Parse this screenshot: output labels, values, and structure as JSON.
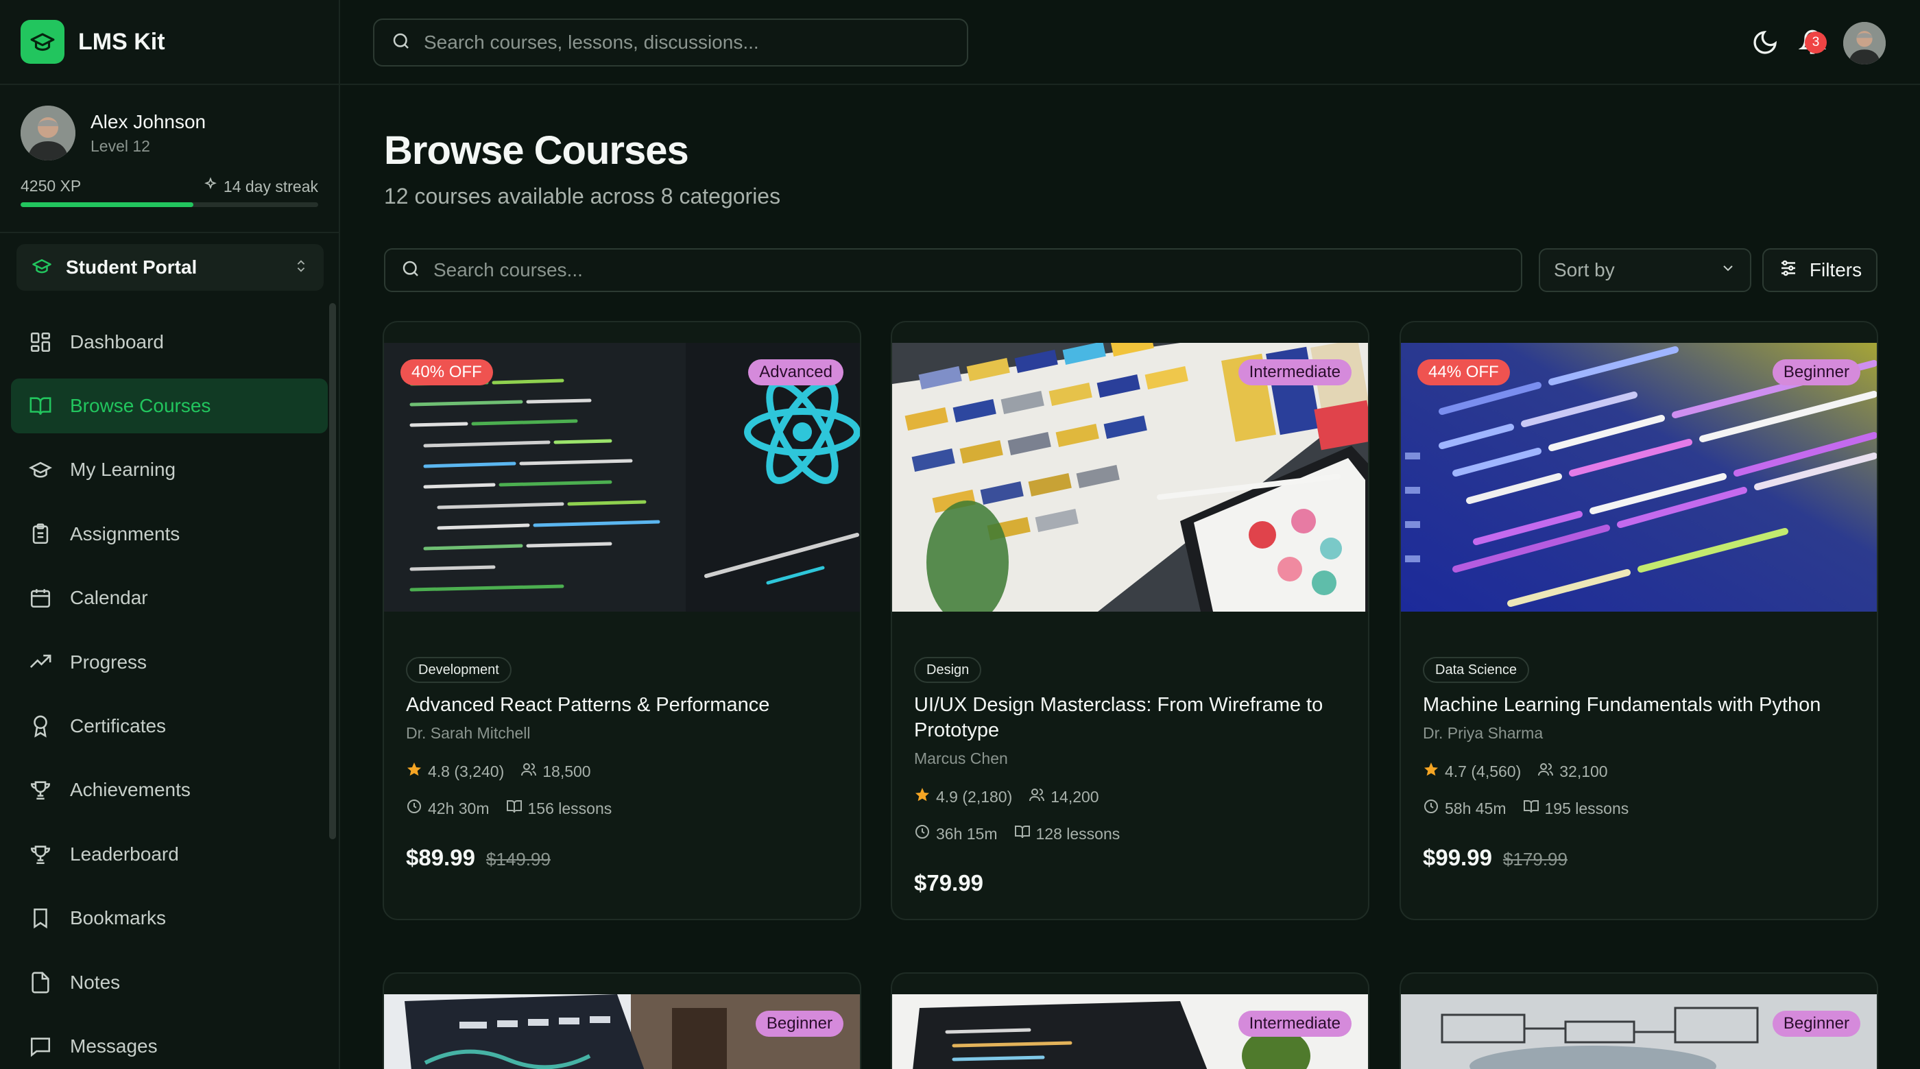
{
  "app": {
    "name": "LMS Kit"
  },
  "user": {
    "name": "Alex Johnson",
    "level": "Level 12",
    "xp": "4250 XP",
    "streak": "14 day streak",
    "xp_progress": 0.58
  },
  "portal": {
    "label": "Student Portal"
  },
  "nav": [
    {
      "label": "Dashboard",
      "icon": "dashboard-icon"
    },
    {
      "label": "Browse Courses",
      "icon": "book-open-icon",
      "active": true
    },
    {
      "label": "My Learning",
      "icon": "graduation-cap-icon"
    },
    {
      "label": "Assignments",
      "icon": "clipboard-icon"
    },
    {
      "label": "Calendar",
      "icon": "calendar-icon"
    },
    {
      "label": "Progress",
      "icon": "trending-up-icon"
    },
    {
      "label": "Certificates",
      "icon": "award-icon"
    },
    {
      "label": "Achievements",
      "icon": "trophy-icon"
    },
    {
      "label": "Leaderboard",
      "icon": "trophy-icon"
    },
    {
      "label": "Bookmarks",
      "icon": "bookmark-icon"
    },
    {
      "label": "Notes",
      "icon": "file-icon"
    },
    {
      "label": "Messages",
      "icon": "message-icon"
    }
  ],
  "topbar": {
    "search_placeholder": "Search courses, lessons, discussions...",
    "notification_count": "3"
  },
  "page": {
    "title": "Browse Courses",
    "subtitle": "12 courses available across 8 categories"
  },
  "toolbar": {
    "search_placeholder": "Search courses...",
    "sort_label": "Sort by",
    "filters_label": "Filters"
  },
  "courses": [
    {
      "category": "Development",
      "title": "Advanced React Patterns & Performance",
      "instructor": "Dr. Sarah Mitchell",
      "rating": "4.8 (3,240)",
      "students": "18,500",
      "duration": "42h 30m",
      "lessons": "156 lessons",
      "price": "$89.99",
      "original_price": "$149.99",
      "discount": "40% OFF",
      "level": "Advanced"
    },
    {
      "category": "Design",
      "title": "UI/UX Design Masterclass: From Wireframe to Prototype",
      "instructor": "Marcus Chen",
      "rating": "4.9 (2,180)",
      "students": "14,200",
      "duration": "36h 15m",
      "lessons": "128 lessons",
      "price": "$79.99",
      "level": "Intermediate"
    },
    {
      "category": "Data Science",
      "title": "Machine Learning Fundamentals with Python",
      "instructor": "Dr. Priya Sharma",
      "rating": "4.7 (4,560)",
      "students": "32,100",
      "duration": "58h 45m",
      "lessons": "195 lessons",
      "price": "$99.99",
      "original_price": "$179.99",
      "discount": "44% OFF",
      "level": "Beginner"
    },
    {
      "level": "Beginner"
    },
    {
      "level": "Intermediate"
    },
    {
      "level": "Beginner"
    }
  ],
  "colors": {
    "accent": "#22c55e",
    "background": "#0b1510",
    "level_badge": "#d58adb",
    "discount_badge": "#ef5350",
    "star": "#f5a524"
  }
}
